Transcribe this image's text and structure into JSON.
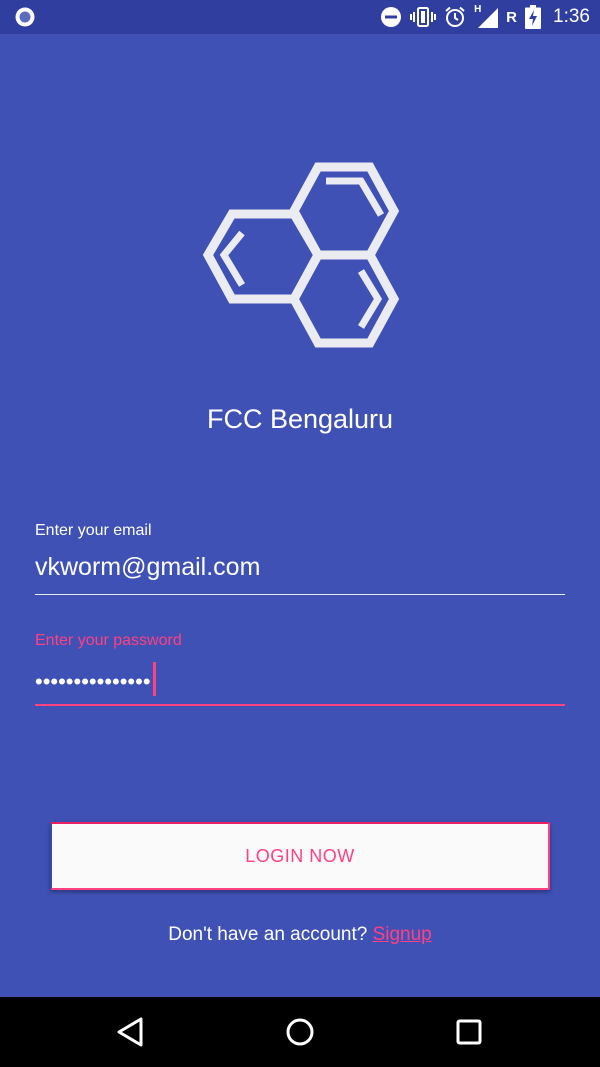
{
  "status_bar": {
    "time": "1:36",
    "network_letter": "R",
    "network_type": "H",
    "icons": [
      "record-icon",
      "do-not-disturb-icon",
      "vibrate-icon",
      "alarm-icon",
      "signal-icon",
      "battery-charging-icon"
    ]
  },
  "app": {
    "title": "FCC Bengaluru",
    "logo_icon": "honeycomb-logo-icon"
  },
  "form": {
    "email_label": "Enter your email",
    "email_value": "vkworm@gmail.com",
    "password_label": "Enter your password",
    "password_masked": "•••••••••••••••",
    "login_label": "LOGIN NOW",
    "signup_prompt": "Don't have an account?",
    "signup_link": "Signup"
  },
  "navigation": {
    "back_icon": "back-triangle-icon",
    "home_icon": "home-circle-icon",
    "recents_icon": "recents-square-icon"
  },
  "colors": {
    "primary": "#3f51b5",
    "primary_dark": "#303f9f",
    "accent": "#ff4081",
    "button_bg": "#fafafa",
    "nav_bg": "#000000"
  }
}
